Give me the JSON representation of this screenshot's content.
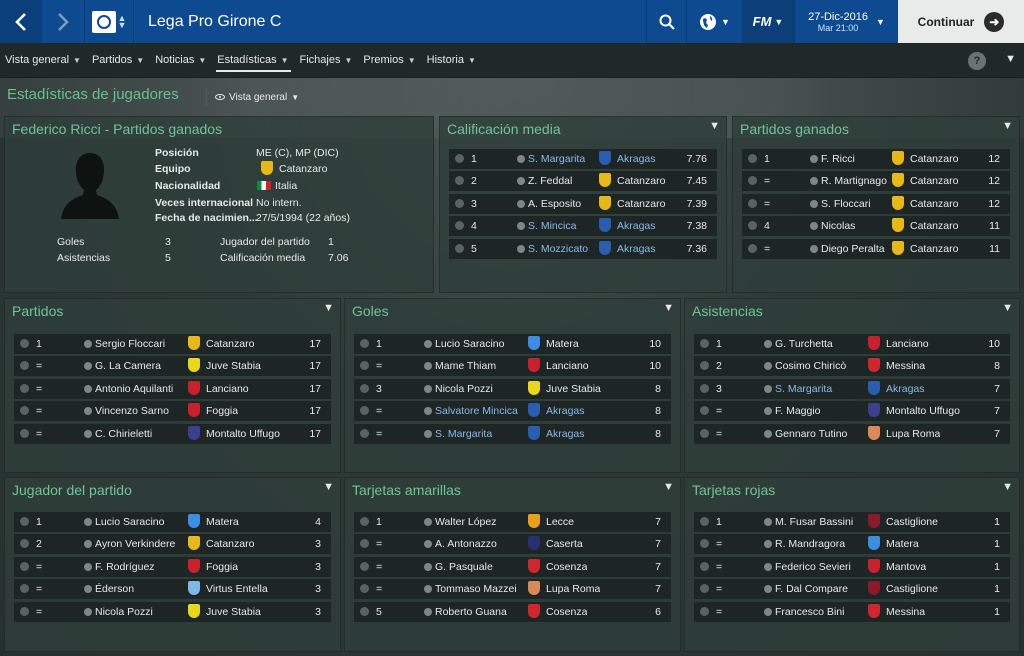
{
  "topbar": {
    "title": "Lega Pro Girone C",
    "date": "27-Dic-2016",
    "day_time": "Mar 21:00",
    "fm_label": "FM",
    "continue_label": "Continuar"
  },
  "menu": [
    {
      "label": "Vista general"
    },
    {
      "label": "Partidos"
    },
    {
      "label": "Noticias"
    },
    {
      "label": "Estadísticas",
      "active": true
    },
    {
      "label": "Fichajes"
    },
    {
      "label": "Premios"
    },
    {
      "label": "Historia"
    }
  ],
  "help_label": "?",
  "page": {
    "title": "Estadísticas de jugadores",
    "view_selector": "Vista general"
  },
  "profile": {
    "title": "Federico Ricci - Partidos ganados",
    "fields": [
      {
        "label": "Posición",
        "value": "ME (C), MP (DIC)"
      },
      {
        "label": "Equipo",
        "value": "Catanzaro"
      },
      {
        "label": "Nacionalidad",
        "value": "Italia"
      },
      {
        "label": "Veces internacional",
        "value": "No intern."
      },
      {
        "label": "Fecha de nacimien...",
        "value": "27/5/1994 (22 años)"
      }
    ],
    "stats": [
      {
        "label": "Goles",
        "value": "3"
      },
      {
        "label": "Asistencias",
        "value": "5"
      },
      {
        "label": "Jugador del partido",
        "value": "1"
      },
      {
        "label": "Calificación media",
        "value": "7.06"
      }
    ]
  },
  "colors": {
    "accent_green": "#6fc498",
    "topbar_blue": "#0d4a8f",
    "link_blue": "#8ab8ea"
  },
  "panels": {
    "calificacion": {
      "title": "Calificación media",
      "rows": [
        {
          "rank": "1",
          "player": "S. Margarita",
          "player_link": true,
          "team": "Akragas",
          "team_link": true,
          "crest": "#2a5db0",
          "value": "7.76"
        },
        {
          "rank": "2",
          "player": "Z. Feddal",
          "team": "Catanzaro",
          "crest": "#e8b816",
          "value": "7.45"
        },
        {
          "rank": "3",
          "player": "A. Esposito",
          "team": "Catanzaro",
          "crest": "#e8b816",
          "value": "7.39"
        },
        {
          "rank": "4",
          "player": "S. Mincica",
          "player_link": true,
          "team": "Akragas",
          "team_link": true,
          "crest": "#2a5db0",
          "value": "7.38"
        },
        {
          "rank": "5",
          "player": "S. Mozzicato",
          "player_link": true,
          "team": "Akragas",
          "team_link": true,
          "crest": "#2a5db0",
          "value": "7.36"
        }
      ]
    },
    "ganados": {
      "title": "Partidos ganados",
      "rows": [
        {
          "rank": "1",
          "player": "F. Ricci",
          "team": "Catanzaro",
          "crest": "#e8b816",
          "value": "12"
        },
        {
          "rank": "=",
          "player": "R. Martignago",
          "team": "Catanzaro",
          "crest": "#e8b816",
          "value": "12"
        },
        {
          "rank": "=",
          "player": "S. Floccari",
          "team": "Catanzaro",
          "crest": "#e8b816",
          "value": "12"
        },
        {
          "rank": "4",
          "player": "Nicolas",
          "team": "Catanzaro",
          "crest": "#e8b816",
          "value": "11"
        },
        {
          "rank": "=",
          "player": "Diego Peralta",
          "team": "Catanzaro",
          "crest": "#e8b816",
          "value": "11"
        }
      ]
    },
    "partidos": {
      "title": "Partidos",
      "rows": [
        {
          "rank": "1",
          "player": "Sergio Floccari",
          "team": "Catanzaro",
          "crest": "#e8b816",
          "value": "17"
        },
        {
          "rank": "=",
          "player": "G. La Camera",
          "team": "Juve Stabia",
          "crest": "#e9d71a",
          "value": "17"
        },
        {
          "rank": "=",
          "player": "Antonio Aquilanti",
          "team": "Lanciano",
          "crest": "#c8202c",
          "value": "17"
        },
        {
          "rank": "=",
          "player": "Vincenzo Sarno",
          "team": "Foggia",
          "crest": "#c8202c",
          "value": "17"
        },
        {
          "rank": "=",
          "player": "C. Chirieletti",
          "team": "Montalto Uffugo",
          "crest": "#3b3f8c",
          "value": "17"
        }
      ]
    },
    "goles": {
      "title": "Goles",
      "rows": [
        {
          "rank": "1",
          "player": "Lucio Saracino",
          "team": "Matera",
          "crest": "#3d8ee0",
          "value": "10"
        },
        {
          "rank": "=",
          "player": "Mame Thiam",
          "team": "Lanciano",
          "crest": "#c8202c",
          "value": "10"
        },
        {
          "rank": "3",
          "player": "Nicola Pozzi",
          "team": "Juve Stabia",
          "crest": "#e9d71a",
          "value": "8"
        },
        {
          "rank": "=",
          "player": "Salvatore Mincica",
          "player_link": true,
          "team": "Akragas",
          "team_link": true,
          "crest": "#2a5db0",
          "value": "8"
        },
        {
          "rank": "=",
          "player": "S. Margarita",
          "player_link": true,
          "team": "Akragas",
          "team_link": true,
          "crest": "#2a5db0",
          "value": "8"
        }
      ]
    },
    "asistencias": {
      "title": "Asistencias",
      "rows": [
        {
          "rank": "1",
          "player": "G. Turchetta",
          "team": "Lanciano",
          "crest": "#c8202c",
          "value": "10"
        },
        {
          "rank": "2",
          "player": "Cosimo Chiricò",
          "team": "Messina",
          "crest": "#d0262e",
          "value": "8"
        },
        {
          "rank": "3",
          "player": "S. Margarita",
          "player_link": true,
          "team": "Akragas",
          "team_link": true,
          "crest": "#2a5db0",
          "value": "7"
        },
        {
          "rank": "=",
          "player": "F. Maggio",
          "team": "Montalto Uffugo",
          "crest": "#3b3f8c",
          "value": "7"
        },
        {
          "rank": "=",
          "player": "Gennaro Tutino",
          "team": "Lupa Roma",
          "crest": "#d98a5a",
          "value": "7"
        }
      ]
    },
    "jugador": {
      "title": "Jugador del partido",
      "rows": [
        {
          "rank": "1",
          "player": "Lucio Saracino",
          "team": "Matera",
          "crest": "#3d8ee0",
          "value": "4"
        },
        {
          "rank": "2",
          "player": "Ayron Verkindere",
          "team": "Catanzaro",
          "crest": "#e8b816",
          "value": "3"
        },
        {
          "rank": "=",
          "player": "F. Rodríguez",
          "team": "Foggia",
          "crest": "#c8202c",
          "value": "3"
        },
        {
          "rank": "=",
          "player": "Éderson",
          "team": "Virtus Entella",
          "crest": "#7fb8e6",
          "value": "3"
        },
        {
          "rank": "=",
          "player": "Nicola Pozzi",
          "team": "Juve Stabia",
          "crest": "#e9d71a",
          "value": "3"
        }
      ]
    },
    "amarillas": {
      "title": "Tarjetas amarillas",
      "rows": [
        {
          "rank": "1",
          "player": "Walter López",
          "team": "Lecce",
          "crest": "#e8a21a",
          "value": "7"
        },
        {
          "rank": "=",
          "player": "A. Antonazzo",
          "team": "Caserta",
          "crest": "#2a2f70",
          "value": "7"
        },
        {
          "rank": "=",
          "player": "G. Pasquale",
          "team": "Cosenza",
          "crest": "#d0262e",
          "value": "7"
        },
        {
          "rank": "=",
          "player": "Tommaso Mazzei",
          "team": "Lupa Roma",
          "crest": "#d98a5a",
          "value": "7"
        },
        {
          "rank": "5",
          "player": "Roberto Guana",
          "team": "Cosenza",
          "crest": "#d0262e",
          "value": "6"
        }
      ]
    },
    "rojas": {
      "title": "Tarjetas rojas",
      "rows": [
        {
          "rank": "1",
          "player": "M. Fusar Bassini",
          "team": "Castiglione",
          "crest": "#8a1a2a",
          "value": "1"
        },
        {
          "rank": "=",
          "player": "R. Mandragora",
          "team": "Matera",
          "crest": "#3d8ee0",
          "value": "1"
        },
        {
          "rank": "=",
          "player": "Federico Sevieri",
          "team": "Mantova",
          "crest": "#c8202c",
          "value": "1"
        },
        {
          "rank": "=",
          "player": "F. Dal Compare",
          "team": "Castiglione",
          "crest": "#8a1a2a",
          "value": "1"
        },
        {
          "rank": "=",
          "player": "Francesco Bini",
          "team": "Messina",
          "crest": "#d0262e",
          "value": "1"
        }
      ]
    }
  }
}
